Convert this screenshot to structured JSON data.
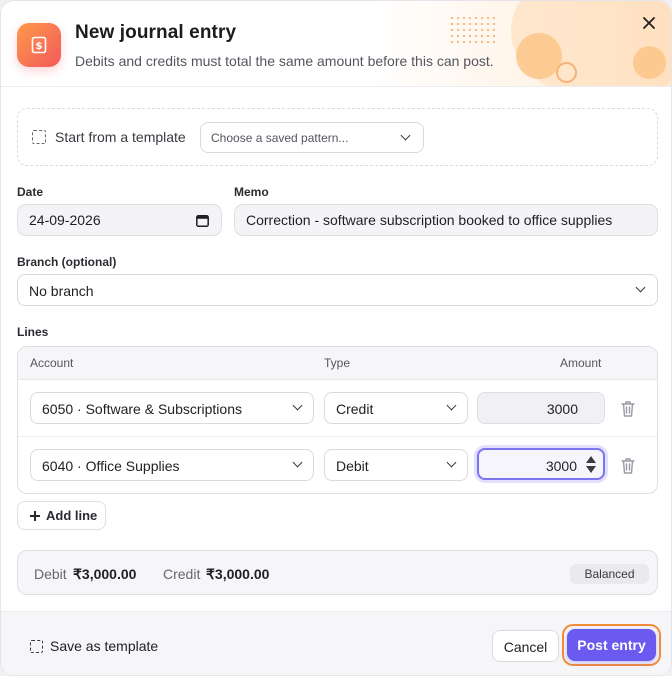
{
  "header": {
    "title": "New journal entry",
    "subtitle": "Debits and credits must total the same amount before this can post.",
    "icon": "receipt-icon"
  },
  "template": {
    "label": "Start from a template",
    "select_value": "Choose a saved pattern..."
  },
  "date": {
    "label": "Date",
    "value": "24-09-2026"
  },
  "memo": {
    "label": "Memo",
    "value": "Correction - software subscription booked to office supplies"
  },
  "branch": {
    "label": "Branch (optional)",
    "value": "No branch"
  },
  "lines": {
    "label": "Lines",
    "columns": {
      "account": "Account",
      "type": "Type",
      "amount": "Amount"
    },
    "rows": [
      {
        "account": "6050 · Software & Subscriptions",
        "type": "Credit",
        "amount": "3000"
      },
      {
        "account": "6040 · Office Supplies",
        "type": "Debit",
        "amount": "3000"
      }
    ],
    "add_label": "Add line"
  },
  "totals": {
    "debit_label": "Debit",
    "debit_value": "₹3,000.00",
    "credit_label": "Credit",
    "credit_value": "₹3,000.00",
    "status": "Balanced"
  },
  "footer": {
    "save_template_label": "Save as template",
    "cancel_label": "Cancel",
    "post_label": "Post entry"
  },
  "colors": {
    "accent": "#6a5af0",
    "focus_ring": "#f38d37",
    "icon_gradient_start": "#ff9a4a",
    "icon_gradient_end": "#f2585b"
  }
}
